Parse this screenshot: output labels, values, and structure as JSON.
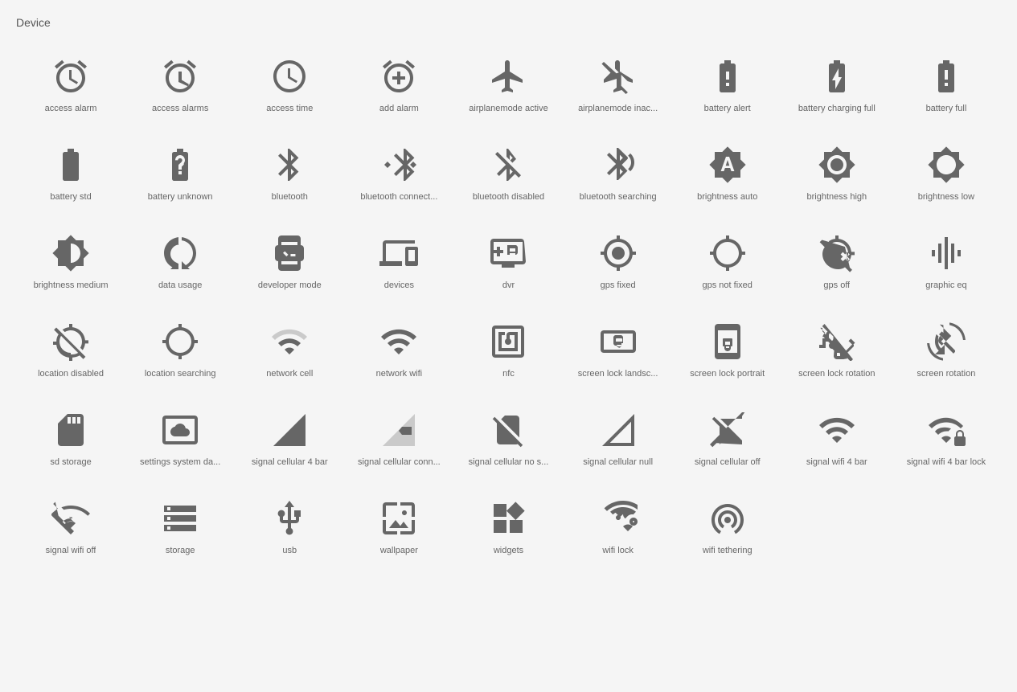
{
  "section": {
    "title": "Device"
  },
  "icons": [
    {
      "name": "access-alarm",
      "label": "access alarm"
    },
    {
      "name": "access-alarms",
      "label": "access alarms"
    },
    {
      "name": "access-time",
      "label": "access time"
    },
    {
      "name": "add-alarm",
      "label": "add alarm"
    },
    {
      "name": "airplanemode-active",
      "label": "airplanemode active"
    },
    {
      "name": "airplanemode-inactive",
      "label": "airplanemode inac..."
    },
    {
      "name": "battery-alert",
      "label": "battery alert"
    },
    {
      "name": "battery-charging-full",
      "label": "battery charging full"
    },
    {
      "name": "battery-full",
      "label": "battery full"
    },
    {
      "name": "battery-std",
      "label": "battery std"
    },
    {
      "name": "battery-unknown",
      "label": "battery unknown"
    },
    {
      "name": "bluetooth",
      "label": "bluetooth"
    },
    {
      "name": "bluetooth-connected",
      "label": "bluetooth connect..."
    },
    {
      "name": "bluetooth-disabled",
      "label": "bluetooth disabled"
    },
    {
      "name": "bluetooth-searching",
      "label": "bluetooth searching"
    },
    {
      "name": "brightness-auto",
      "label": "brightness auto"
    },
    {
      "name": "brightness-high",
      "label": "brightness high"
    },
    {
      "name": "brightness-low",
      "label": "brightness low"
    },
    {
      "name": "brightness-medium",
      "label": "brightness medium"
    },
    {
      "name": "data-usage",
      "label": "data usage"
    },
    {
      "name": "developer-mode",
      "label": "developer mode"
    },
    {
      "name": "devices",
      "label": "devices"
    },
    {
      "name": "dvr",
      "label": "dvr"
    },
    {
      "name": "gps-fixed",
      "label": "gps fixed"
    },
    {
      "name": "gps-not-fixed",
      "label": "gps not fixed"
    },
    {
      "name": "gps-off",
      "label": "gps off"
    },
    {
      "name": "graphic-eq",
      "label": "graphic eq"
    },
    {
      "name": "location-disabled",
      "label": "location disabled"
    },
    {
      "name": "location-searching",
      "label": "location searching"
    },
    {
      "name": "network-cell",
      "label": "network cell"
    },
    {
      "name": "network-wifi",
      "label": "network wifi"
    },
    {
      "name": "nfc",
      "label": "nfc"
    },
    {
      "name": "screen-lock-landscape",
      "label": "screen lock landsc..."
    },
    {
      "name": "screen-lock-portrait",
      "label": "screen lock portrait"
    },
    {
      "name": "screen-lock-rotation",
      "label": "screen lock rotation"
    },
    {
      "name": "screen-rotation",
      "label": "screen rotation"
    },
    {
      "name": "sd-storage",
      "label": "sd storage"
    },
    {
      "name": "settings-system-daydream",
      "label": "settings system da..."
    },
    {
      "name": "signal-cellular-4-bar",
      "label": "signal cellular 4 bar"
    },
    {
      "name": "signal-cellular-connected",
      "label": "signal cellular conn..."
    },
    {
      "name": "signal-cellular-no-sim",
      "label": "signal cellular no s..."
    },
    {
      "name": "signal-cellular-null",
      "label": "signal cellular null"
    },
    {
      "name": "signal-cellular-off",
      "label": "signal cellular off"
    },
    {
      "name": "signal-wifi-4-bar",
      "label": "signal wifi 4 bar"
    },
    {
      "name": "signal-wifi-4-bar-lock",
      "label": "signal wifi 4 bar lock"
    },
    {
      "name": "signal-wifi-off",
      "label": "signal wifi off"
    },
    {
      "name": "storage",
      "label": "storage"
    },
    {
      "name": "usb",
      "label": "usb"
    },
    {
      "name": "wallpaper",
      "label": "wallpaper"
    },
    {
      "name": "widgets",
      "label": "widgets"
    },
    {
      "name": "wifi-lock",
      "label": "wifi lock"
    },
    {
      "name": "wifi-tethering",
      "label": "wifi tethering"
    }
  ]
}
